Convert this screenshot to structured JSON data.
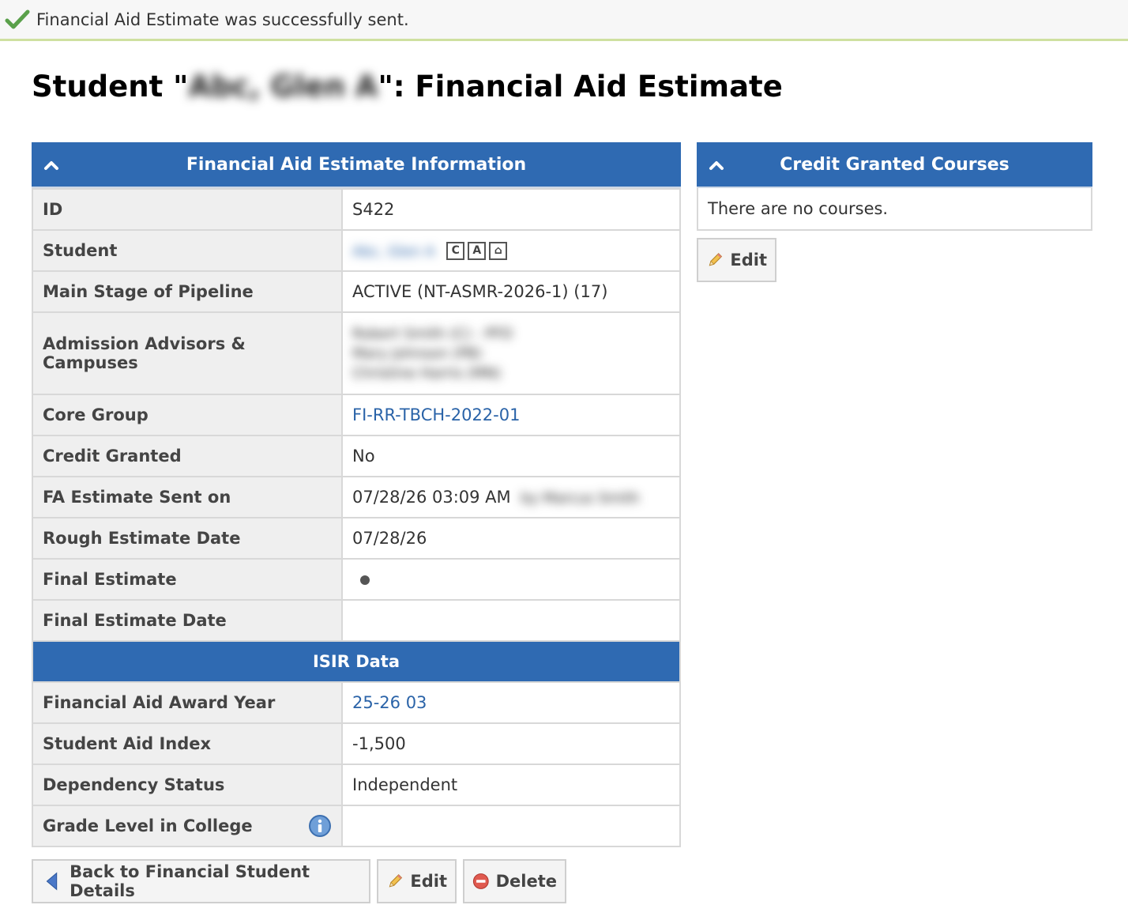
{
  "notice": {
    "text": "Financial Aid Estimate was successfully sent."
  },
  "title": {
    "prefix": "Student \"",
    "student_name": "Abc, Glen A",
    "suffix": "\": Financial Aid Estimate"
  },
  "info_panel": {
    "header": "Financial Aid Estimate Information",
    "rows": [
      {
        "label": "ID",
        "value": "S422"
      },
      {
        "label": "Student",
        "value": "Abc, Glen A",
        "icons": [
          "C",
          "A",
          "⌂"
        ]
      },
      {
        "label": "Main Stage of Pipeline",
        "value": "ACTIVE (NT-ASMR-2026-1) (17)"
      },
      {
        "label": "Admission Advisors & Campuses",
        "value_lines": [
          "Robert Smith (C) - PFD",
          "Mary Johnson (PB)",
          "Christine Harris (MN)"
        ]
      },
      {
        "label": "Core Group",
        "value": "FI-RR-TBCH-2022-01"
      },
      {
        "label": "Credit Granted",
        "value": "No"
      },
      {
        "label": "FA Estimate Sent on",
        "value": "07/28/26 03:09 AM",
        "by": "by Marcus Smith"
      },
      {
        "label": "Rough Estimate Date",
        "value": "07/28/26"
      },
      {
        "label": "Final Estimate",
        "value": ""
      },
      {
        "label": "Final Estimate Date",
        "value": ""
      }
    ],
    "isir_header": "ISIR Data",
    "isir_rows": [
      {
        "label": "Financial Aid Award Year",
        "value": "25-26 03"
      },
      {
        "label": "Student Aid Index",
        "value": "-1,500"
      },
      {
        "label": "Dependency Status",
        "value": "Independent"
      },
      {
        "label": "Grade Level in College",
        "value": ""
      }
    ]
  },
  "credit_panel": {
    "header": "Credit Granted Courses",
    "empty_text": "There are no courses.",
    "edit_label": "Edit"
  },
  "actions": {
    "back_label": "Back to Financial Student Details",
    "edit_label": "Edit",
    "delete_label": "Delete"
  },
  "colors": {
    "header_blue": "#2f6ab2",
    "link_blue": "#2a63a8",
    "label_bg": "#efefef"
  }
}
